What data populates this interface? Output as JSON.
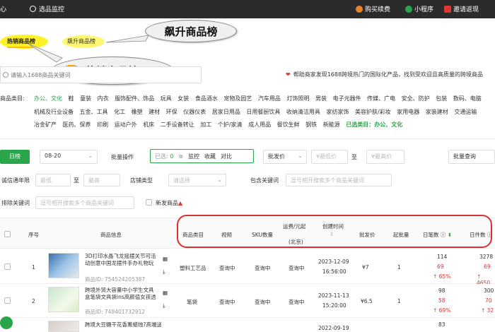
{
  "topbar": {
    "logo_fragment": "心",
    "nav_item": "选品监控",
    "buy": "购买续费",
    "mini_program": "小程序",
    "invite": "邀请返现",
    "colors": {
      "background": "#2b2b2b",
      "buy_icon": "#e8822a",
      "mini_icon": "#2aa64a",
      "invite_icon": "#e0362c"
    }
  },
  "tabs": {
    "hot": "热销商品榜",
    "rising": "飙升商品榜"
  },
  "callouts": {
    "rising": "飙升商品榜",
    "hot": "热销商品榜"
  },
  "search": {
    "placeholder": "请输入1688商品关键词"
  },
  "notice": "帮助商家发现1688跨境热门的国际化产品，找到受欢迎且高质量的跨境商品",
  "categories": {
    "label": "商品类目:",
    "row1": [
      "办公、文化",
      "鞋",
      "童装",
      "内衣",
      "服饰配件、饰品",
      "玩具",
      "女装",
      "食品酒水",
      "宠物及园艺",
      "汽车用品",
      "灯饰照明",
      "男装",
      "电子元器件",
      "传媒、广电",
      "安全、防护",
      "包装",
      "数码、电脑"
    ],
    "row2": [
      "机械及行业设备",
      "五金、工具",
      "化工",
      "橡塑",
      "建材",
      "环保",
      "仪器仪表",
      "居家日用品",
      "日用餐厨饮具",
      "收纳清洁用具",
      "家纺家饰",
      "美容护肤/彩妆",
      "家用电器",
      "家装建材",
      "交通运输"
    ],
    "row3": [
      "冶金矿产",
      "医药、保养",
      "印刷",
      "运动户外",
      "机床",
      "二手设备转让",
      "加工",
      "个护/家清",
      "成人用品",
      "餐饮生鲜",
      "钢铁",
      "新能源"
    ],
    "selected_label": "已选类目：办公、文化"
  },
  "filters": {
    "period_btn": "日榜",
    "date": "08-20",
    "batch_label": "批量操作",
    "selected_prefix": "已选:",
    "selected_count": "0",
    "monitor": "监控",
    "favorite": "收藏",
    "compare": "对比",
    "price_type": "批发价",
    "min_price": "¥最低价",
    "to": "至",
    "max_price": "¥最高价",
    "batch_query": "批量查询",
    "integrity_label": "诚信通年限",
    "min": "最低",
    "max": "最高",
    "shop_type_label": "店铺类型",
    "shop_type_placeholder": "请选择",
    "include_kw_label": "包含关键词",
    "kw_placeholder": "逗号相开搜索多个商品关键词",
    "exclude_kw_label": "排除关键词",
    "new_goods": "新发商品"
  },
  "table": {
    "headers": {
      "index": "序号",
      "info": "商品信息",
      "category": "商品类目",
      "video": "视频",
      "sku": "SKU数量",
      "shipping": "运费/元起",
      "shipping_sub": "(北京)",
      "created": "创建时间",
      "wholesale": "批发价",
      "moq": "起批量",
      "daily_orders": "日笔数",
      "daily_pieces": "日件数"
    },
    "rows": [
      {
        "index": "1",
        "title": "3D打印水晶飞龙摇摆关节可活动创意中国龙摆件手办礼物玩具网课爆款",
        "id_label": "商品ID:",
        "id": "754524205387",
        "category": "塑料工艺品",
        "video": "查询中",
        "sku": "查询中",
        "shipping": "查询中",
        "date": "2023-12-09",
        "time": "16:56:00",
        "price": "¥7",
        "moq": "1",
        "orders": "114",
        "orders_prev": "69",
        "orders_change": "↑ 65%",
        "pieces": "3278",
        "pieces_prev": "69",
        "pieces_change": "↑ 4650"
      },
      {
        "index": "2",
        "title": "跨境外贸大容量中小学生文具盒笔袋文具袋ins高颜值女孩透明笔袋",
        "id_label": "商品ID:",
        "id": "748401732912",
        "category": "笔袋",
        "video": "查询中",
        "sku": "查询中",
        "shipping": "查询中",
        "date": "2023-11-13",
        "time": "15:20:00",
        "price": "¥6.5",
        "moq": "1",
        "orders": "98",
        "orders_prev": "58",
        "orders_change": "↑ 69%",
        "pieces": "300",
        "pieces_prev": "70",
        "pieces_change": "↑ 32"
      },
      {
        "index": "3",
        "title": "跨境大豆糖干花香薰蜡烛?高端送礼手",
        "date": "2022-09-19",
        "orders": "83"
      }
    ]
  }
}
